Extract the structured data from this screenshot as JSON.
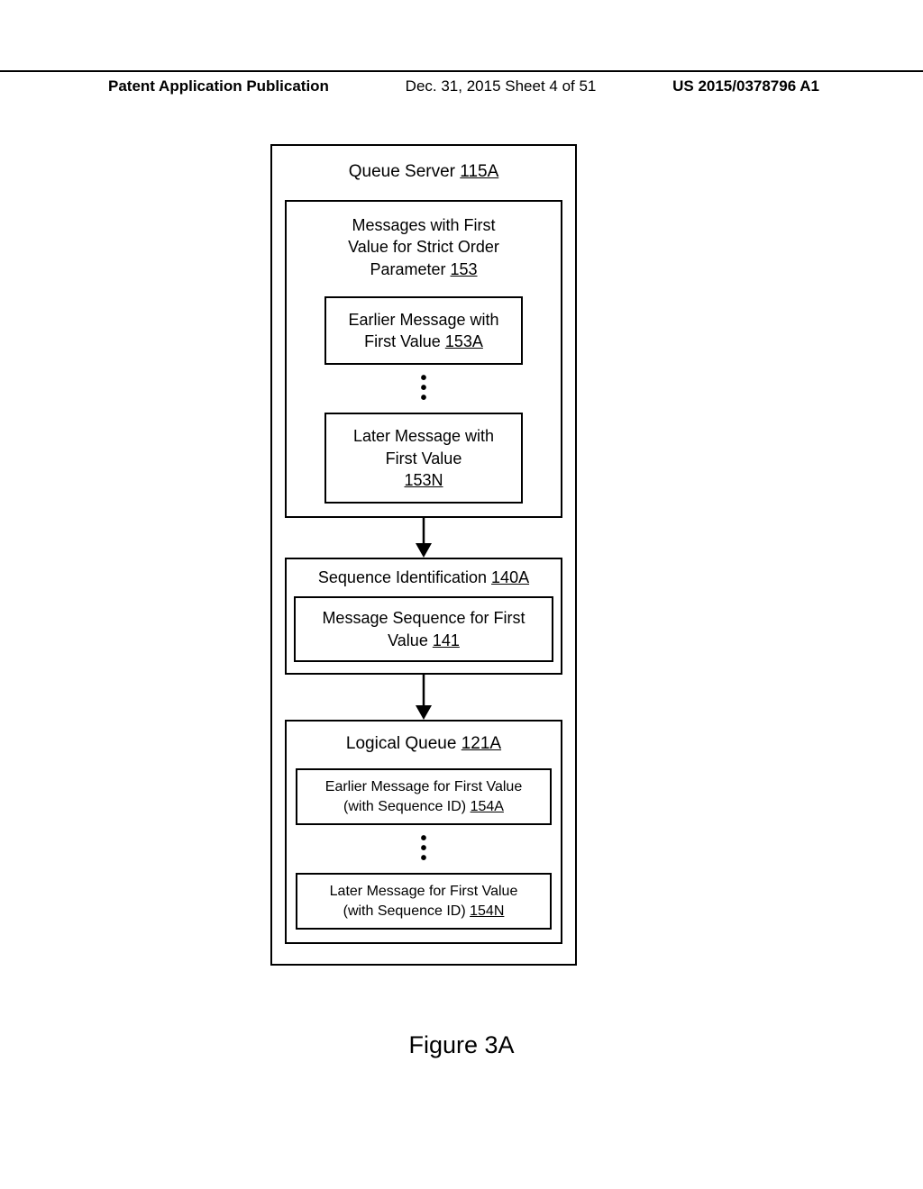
{
  "header": {
    "left": "Patent Application Publication",
    "mid": "Dec. 31, 2015  Sheet 4 of 51",
    "right": "US 2015/0378796 A1"
  },
  "outer": {
    "title_text": "Queue Server ",
    "title_ref": "115A"
  },
  "messages_box": {
    "title_l1": "Messages with First",
    "title_l2": "Value for Strict Order",
    "title_l3_text": "Parameter ",
    "title_l3_ref": "153",
    "earlier_l1": "Earlier Message with",
    "earlier_l2_text": "First Value ",
    "earlier_l2_ref": "153A",
    "later_l1": "Later Message with",
    "later_l2": "First Value",
    "later_ref": "153N"
  },
  "seq_box": {
    "title_text": "Sequence Identification ",
    "title_ref": "140A",
    "inner_l1": "Message Sequence for First",
    "inner_l2_text": "Value ",
    "inner_l2_ref": "141"
  },
  "queue_box": {
    "title_text": "Logical Queue ",
    "title_ref": "121A",
    "earlier_l1": "Earlier Message for First Value",
    "earlier_l2_text": "(with Sequence ID) ",
    "earlier_l2_ref": "154A",
    "later_l1": "Later Message for First Value",
    "later_l2_text": "(with Sequence ID) ",
    "later_l2_ref": "154N"
  },
  "figure_label": "Figure 3A"
}
